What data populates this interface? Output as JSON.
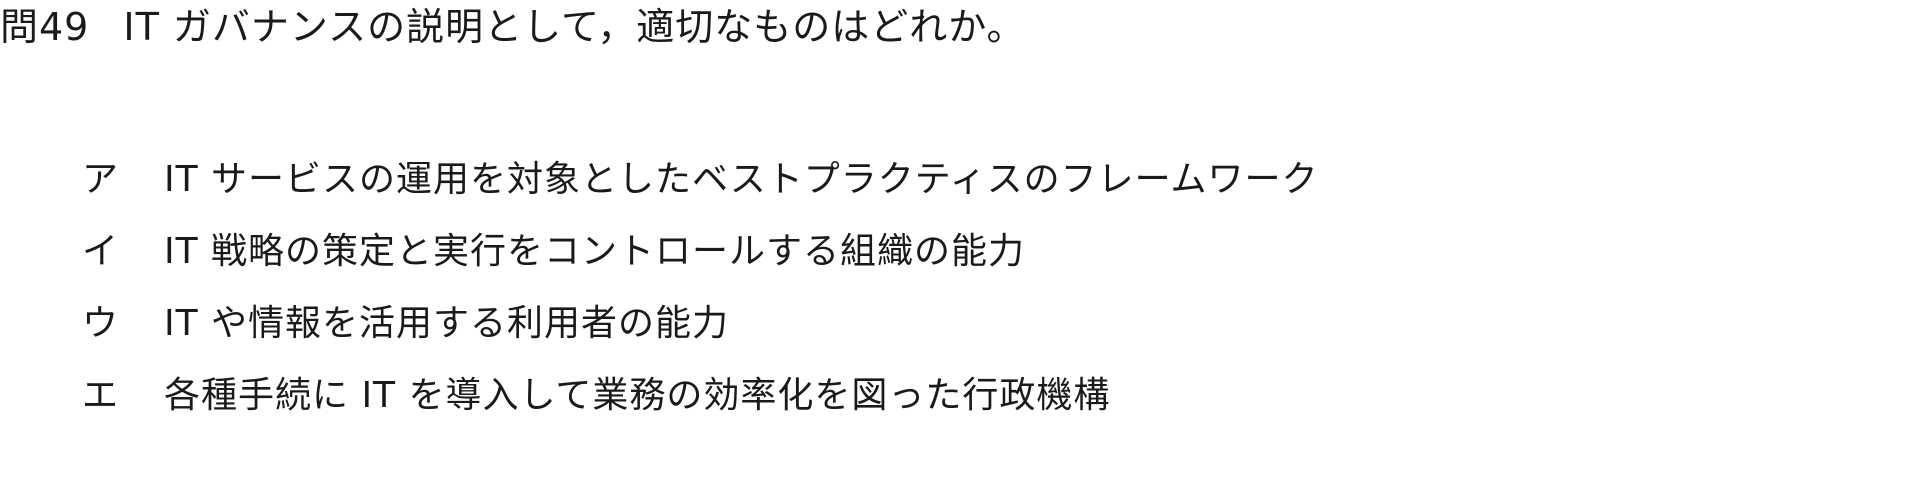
{
  "question": {
    "number": "問49",
    "text": "IT ガバナンスの説明として，適切なものはどれか。"
  },
  "choices": [
    {
      "label": "ア",
      "text": "IT サービスの運用を対象としたベストプラクティスのフレームワーク"
    },
    {
      "label": "イ",
      "text": "IT 戦略の策定と実行をコントロールする組織の能力"
    },
    {
      "label": "ウ",
      "text": "IT や情報を活用する利用者の能力"
    },
    {
      "label": "エ",
      "text": "各種手続に IT を導入して業務の効率化を図った行政機構"
    }
  ]
}
